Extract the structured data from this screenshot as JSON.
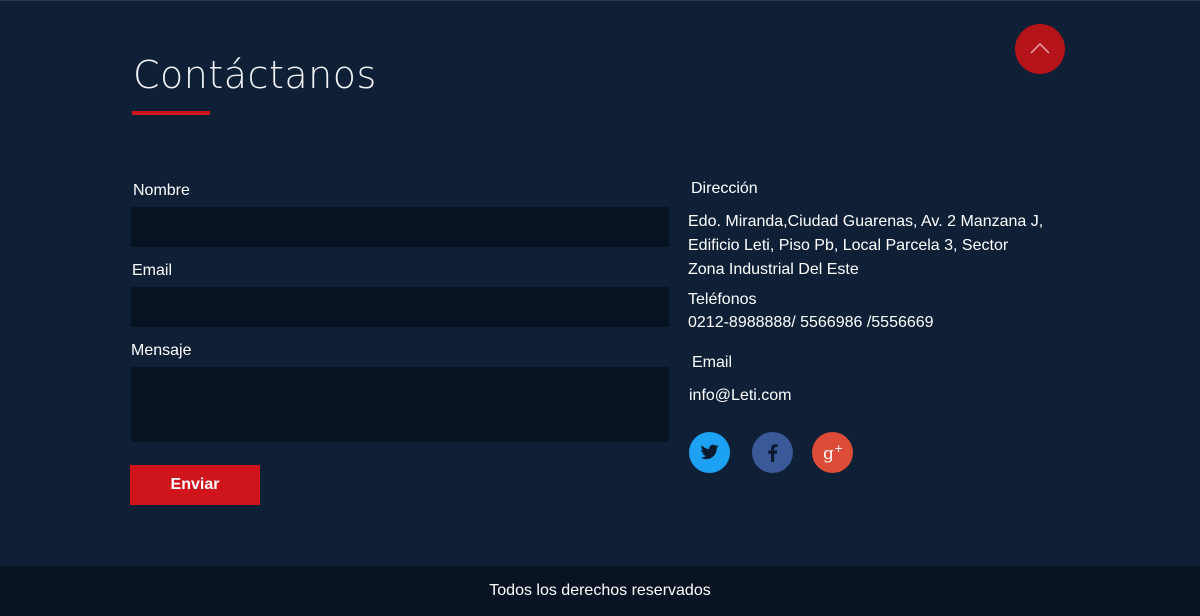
{
  "header": {
    "title": "Contáctanos"
  },
  "form": {
    "name_label": "Nombre",
    "name_value": "",
    "email_label": "Email",
    "email_value": "",
    "message_label": "Mensaje",
    "message_value": "",
    "submit_label": "Enviar"
  },
  "info": {
    "address_label": "Dirección",
    "address_lines": [
      "Edo. Miranda,Ciudad Guarenas, Av. 2 Manzana J,",
      "Edificio Leti, Piso Pb, Local Parcela 3, Sector",
      "Zona Industrial Del Este"
    ],
    "phones_label": "Teléfonos",
    "phones_value": "0212-8988888/ 5566986 /5556669",
    "email_label": "Email",
    "email_value": "info@Leti.com"
  },
  "social": {
    "icons": [
      "twitter-icon",
      "facebook-icon",
      "google-plus-icon"
    ]
  },
  "footer": {
    "text": "Todos los derechos reservados"
  },
  "colors": {
    "background": "#0e1f36",
    "field_background": "#071222",
    "accent_red": "#d0141b",
    "scroll_button": "#b5131a",
    "twitter": "#1da1f2",
    "facebook": "#3b5998",
    "google_plus": "#dd4b39"
  }
}
